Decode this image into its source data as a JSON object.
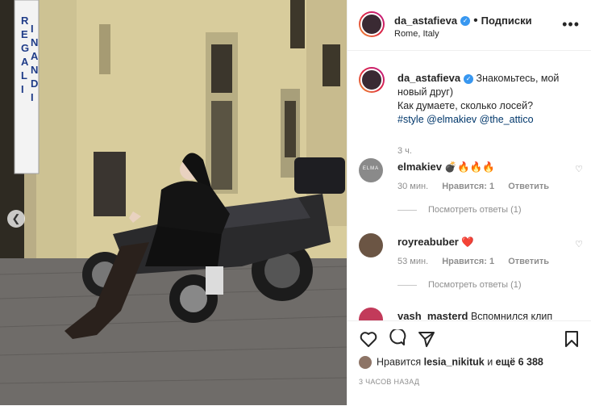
{
  "post": {
    "username": "da_astafieva",
    "follow_label": "Подписки",
    "location": "Rome, Italy",
    "more_label": "•••",
    "sign_text": "REGALI IN ANDI"
  },
  "caption": {
    "username": "da_astafieva",
    "line1": "Знакомьтесь, мой",
    "line2": "новый друг)",
    "line3": "Как думаете, сколько лосей?",
    "tag1": "#style",
    "tag2": "@elmakiev",
    "tag3": "@the_attico",
    "age": "3 ч."
  },
  "comments": [
    {
      "username": "elmakiev",
      "text": "💣🔥🔥🔥",
      "age": "30 мин.",
      "likes": "Нравится: 1",
      "reply": "Ответить",
      "view_replies": "Посмотреть ответы (1)",
      "avatar_text": "ELMA"
    },
    {
      "username": "royreabuber",
      "text": "❤️",
      "age": "53 мин.",
      "likes": "Нравится: 1",
      "reply": "Ответить",
      "view_replies": "Посмотреть ответы (1)"
    },
    {
      "username": "vash_masterd",
      "text": "Вспомнился клип"
    }
  ],
  "footer": {
    "likes_prefix": "Нравится",
    "likes_user": "lesia_nikituk",
    "likes_and": "и",
    "likes_more": "ещё 6 388",
    "timestamp": "3 ЧАСОВ НАЗАД"
  },
  "colors": {
    "accent": "#3897f0",
    "heart": "#ed4956"
  },
  "icons": [
    "heart-icon",
    "comment-icon",
    "share-icon",
    "bookmark-icon",
    "verified-icon",
    "more-icon",
    "chevron-left-icon"
  ]
}
